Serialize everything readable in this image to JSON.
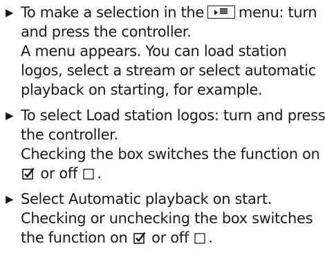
{
  "steps": [
    {
      "lines": [
        {
          "before": "To make a selection in the",
          "after": "menu: turn"
        },
        "and press the controller.",
        "A menu appears. You can load station",
        "logos, select a stream or select automatic",
        "playback on starting, for example."
      ]
    },
    {
      "lines": [
        "To select Load station logos: turn and press",
        "the controller.",
        "Checking the box switches the function on",
        {
          "mid": "or off",
          "end": "."
        }
      ]
    },
    {
      "lines": [
        "Select Automatic playback on start.",
        "Checking or unchecking the box switches",
        {
          "before": "the function on",
          "mid": "or off",
          "end": "."
        }
      ]
    }
  ],
  "icons": {
    "menu": "media-menu-icon",
    "checked": "checkbox-checked-icon",
    "unchecked": "checkbox-unchecked-icon"
  },
  "colors": {
    "text": "#1a1a1a",
    "background": "#ffffff"
  }
}
